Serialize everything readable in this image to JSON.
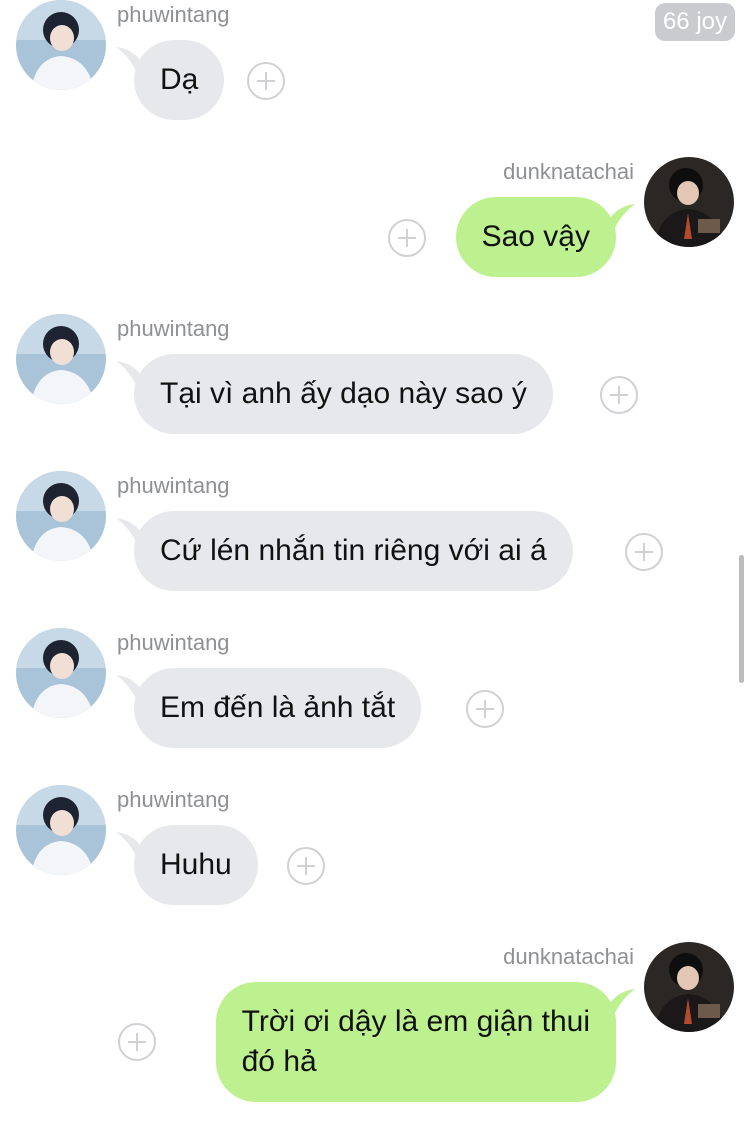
{
  "header": {
    "badge": "66 joy"
  },
  "messages": [
    {
      "side": "in",
      "user": "phuwintang",
      "text": "Dạ"
    },
    {
      "side": "out",
      "user": "dunknatachai",
      "text": "Sao vậy"
    },
    {
      "side": "in",
      "user": "phuwintang",
      "text": "Tại vì anh ấy dạo này sao ý"
    },
    {
      "side": "in",
      "user": "phuwintang",
      "text": "Cứ lén nhắn tin riêng với ai á"
    },
    {
      "side": "in",
      "user": "phuwintang",
      "text": "Em đến là ảnh tắt"
    },
    {
      "side": "in",
      "user": "phuwintang",
      "text": "Huhu"
    },
    {
      "side": "out",
      "user": "dunknatachai",
      "text": "Trời ơi dậy là em giận thui\nđó hả"
    }
  ],
  "colors": {
    "incoming_bubble": "#e6e8eb",
    "outgoing_bubble": "#bdf08f",
    "badge": "#c9cbce"
  },
  "icons": {
    "add_reaction": "plus-circle-icon"
  }
}
